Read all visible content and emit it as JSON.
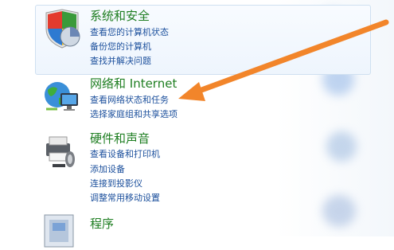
{
  "categories": [
    {
      "title": "系统和安全",
      "icon": "shield-icon",
      "links": [
        "查看您的计算机状态",
        "备份您的计算机",
        "查找并解决问题"
      ]
    },
    {
      "title": "网络和 Internet",
      "icon": "network-globe-icon",
      "links": [
        "查看网络状态和任务",
        "选择家庭组和共享选项"
      ]
    },
    {
      "title": "硬件和声音",
      "icon": "printer-icon",
      "links": [
        "查看设备和打印机",
        "添加设备",
        "连接到投影仪",
        "调整常用移动设置"
      ]
    },
    {
      "title": "程序",
      "icon": "programs-icon",
      "links": []
    }
  ],
  "colors": {
    "title_green": "#1e7e21",
    "link_blue": "#1b4f9c",
    "arrow_orange": "#f2852a"
  }
}
